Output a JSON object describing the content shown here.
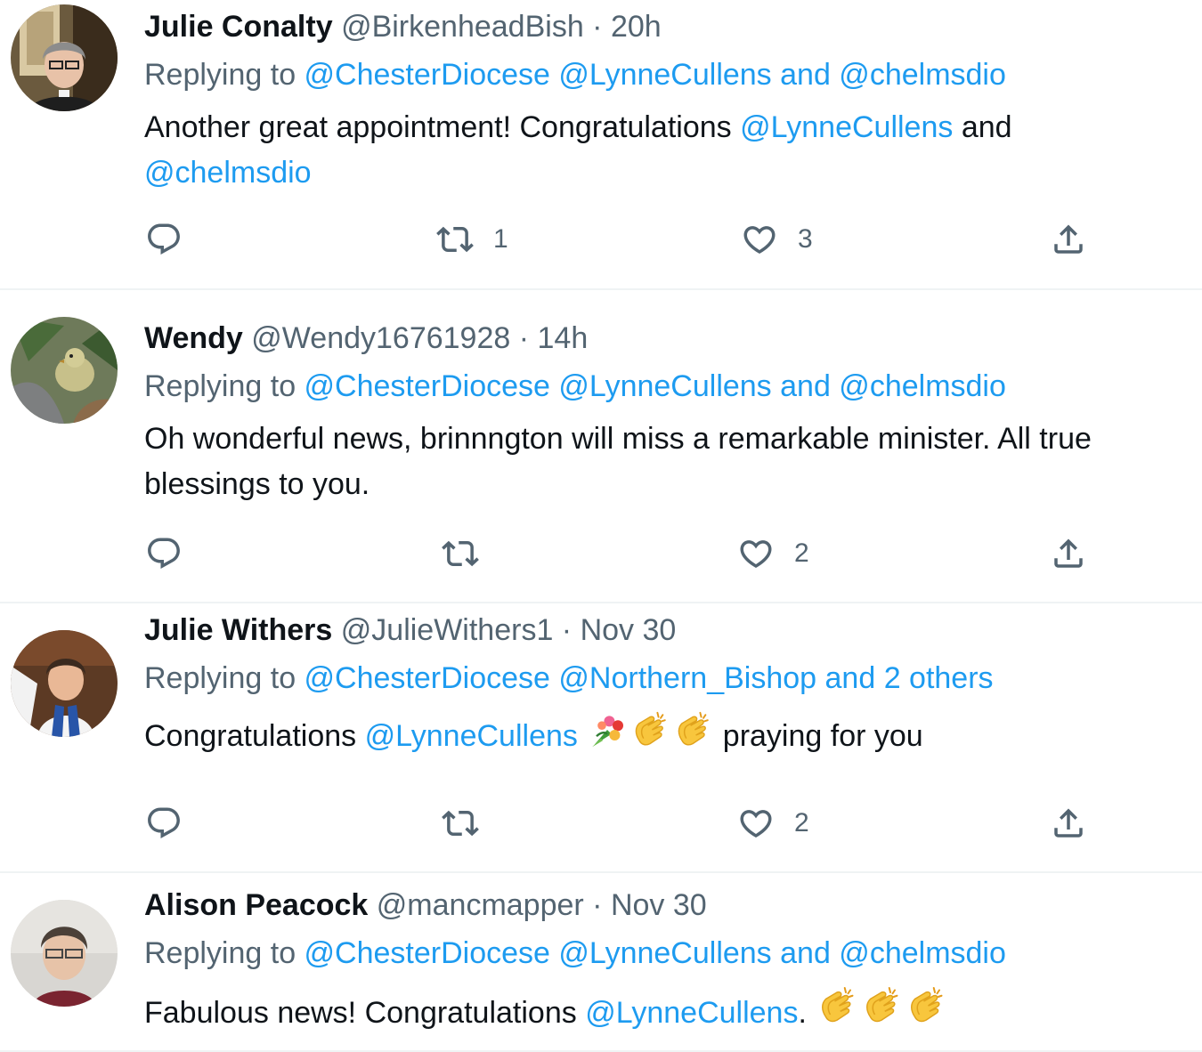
{
  "tweets": [
    {
      "name": "Julie Conalty",
      "handle": "@BirkenheadBish",
      "dot": " · ",
      "time": "20h",
      "replying_prefix": "Replying to ",
      "replying_mention1": "@ChesterDiocese",
      "replying_mention2": "@LynneCullens and @chelmsdio",
      "text_part1": "Another great appointment! Congratulations ",
      "text_mention1": "@LynneCullens",
      "text_part2": " and ",
      "text_mention2": "@chelmsdio",
      "reply_count": "",
      "retweet_count": "1",
      "like_count": "3"
    },
    {
      "name": "Wendy",
      "handle": "@Wendy16761928",
      "dot": " · ",
      "time": "14h",
      "replying_prefix": "Replying to ",
      "replying_mention1": "@ChesterDiocese",
      "replying_mention2": "@LynneCullens and @chelmsdio",
      "text_part1": "Oh wonderful news, brinnngton will miss a remarkable minister. All true blessings to you.",
      "reply_count": "",
      "retweet_count": "",
      "like_count": "2"
    },
    {
      "name": "Julie Withers",
      "handle": "@JulieWithers1",
      "dot": " · ",
      "time": "Nov 30",
      "replying_prefix": "Replying to ",
      "replying_mention1": "@ChesterDiocese",
      "replying_mention2": "@Northern_Bishop and 2 others",
      "text_part1": "Congratulations ",
      "text_mention1": "@LynneCullens",
      "text_part2": " praying for you",
      "emojis": [
        "bouquet-emoji",
        "clapping-hands-emoji",
        "clapping-hands-emoji"
      ],
      "reply_count": "",
      "retweet_count": "",
      "like_count": "2"
    },
    {
      "name": "Alison Peacock",
      "handle": "@mancmapper",
      "dot": " · ",
      "time": "Nov 30",
      "replying_prefix": "Replying to ",
      "replying_mention1": "@ChesterDiocese",
      "replying_mention2": "@LynneCullens and @chelmsdio",
      "text_part1": "Fabulous news! Congratulations ",
      "text_mention1": "@LynneCullens",
      "text_part2": ". ",
      "emojis": [
        "clapping-hands-emoji",
        "clapping-hands-emoji",
        "clapping-hands-emoji"
      ]
    }
  ],
  "icons": {
    "reply": "reply-icon",
    "retweet": "retweet-icon",
    "like": "like-icon",
    "share": "share-icon"
  },
  "colors": {
    "link": "#1d9bf0",
    "secondary_text": "#536471",
    "primary_text": "#0f1419",
    "divider": "#eff3f4"
  }
}
